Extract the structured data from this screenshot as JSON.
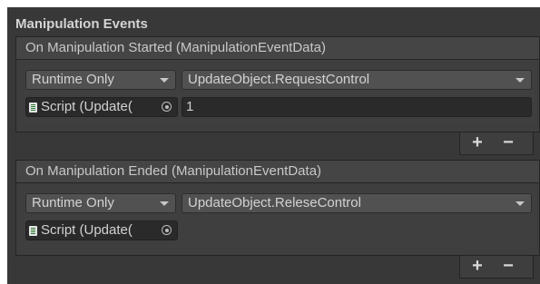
{
  "section": {
    "title": "Manipulation Events"
  },
  "events": [
    {
      "header": "On Manipulation Started (ManipulationEventData)",
      "runtime": "Runtime Only",
      "function": "UpdateObject.RequestControl",
      "object": "Script (Update(",
      "argument": "1",
      "add_label": "+",
      "remove_label": "−"
    },
    {
      "header": "On Manipulation Ended (ManipulationEventData)",
      "runtime": "Runtime Only",
      "function": "UpdateObject.ReleseControl",
      "object": "Script (Update(",
      "add_label": "+",
      "remove_label": "−"
    }
  ],
  "icons": {
    "script": "script-icon",
    "picker": "object-picker-icon",
    "dropdown": "chevron-down-icon"
  }
}
